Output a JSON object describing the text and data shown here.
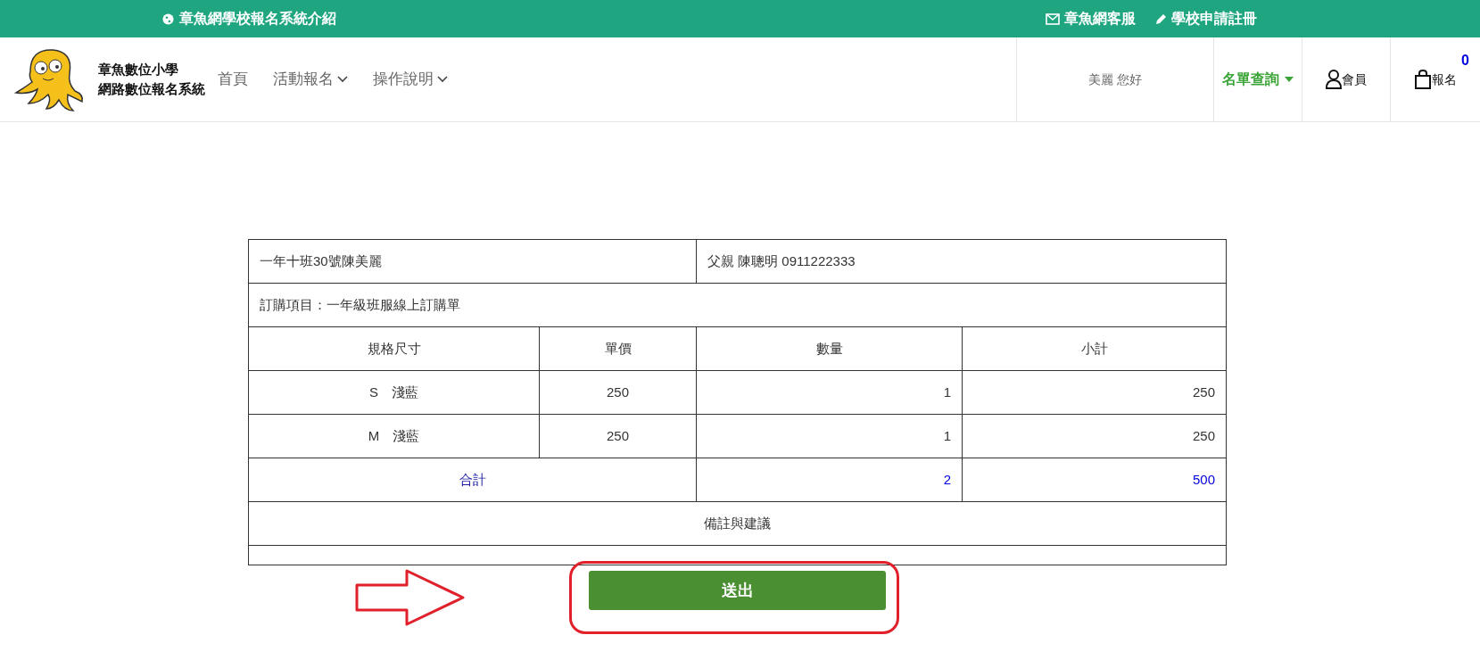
{
  "top_bar": {
    "left_link": "章魚網學校報名系統介紹",
    "right_links": [
      {
        "kind": "mail",
        "label": "章魚網客服"
      },
      {
        "kind": "pencil",
        "label": "學校申請註冊"
      }
    ]
  },
  "header": {
    "site_name": [
      "章魚數位小學",
      "網路數位報名系統"
    ],
    "nav": [
      {
        "label": "首頁",
        "dropdown": false
      },
      {
        "label": "活動報名",
        "dropdown": true
      },
      {
        "label": "操作說明",
        "dropdown": true
      }
    ],
    "greeting": "美麗 您好",
    "list_query": "名單查詢",
    "member": "會員",
    "signup": "報名",
    "cart_count": "0"
  },
  "order": {
    "student": "一年十班30號陳美麗",
    "parent": "父親 陳聰明 0911222333",
    "item": "訂購項目：一年級班服線上訂購單",
    "columns": [
      "規格尺寸",
      "單價",
      "數量",
      "小計"
    ],
    "rows": [
      [
        "S　淺藍",
        "250",
        "1",
        "250"
      ],
      [
        "M　淺藍",
        "250",
        "1",
        "250"
      ]
    ],
    "total": {
      "label": "合計",
      "quantity": "2",
      "amount": "500"
    },
    "notes_heading": "備註與建議"
  },
  "submit_button": "送出"
}
